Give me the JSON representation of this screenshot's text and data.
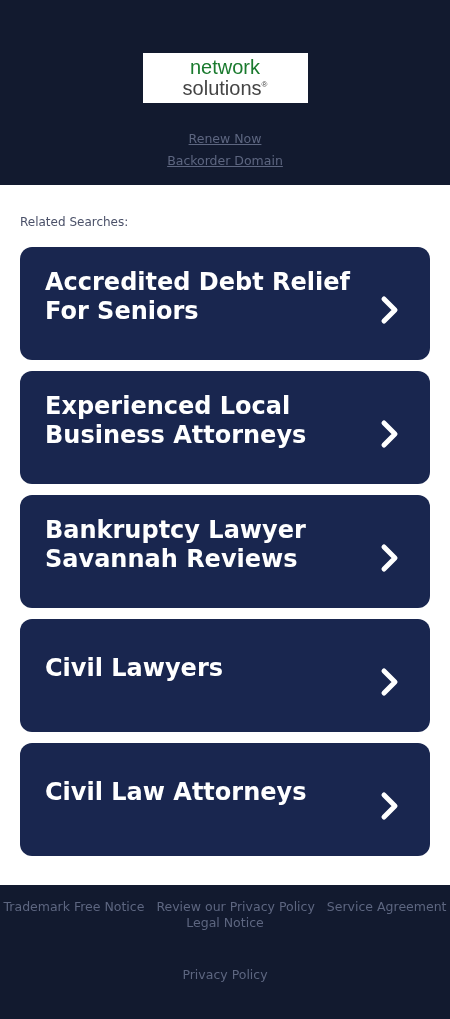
{
  "header": {
    "logo": {
      "line_1": "network",
      "line_2": "solutions$^{®}$"
    },
    "links": [
      "Renew Now",
      "Backorder Domain"
    ]
  },
  "related_searches": {
    "title": "Related Searches:",
    "items": [
      "Accredited Debt Relief For Seniors",
      "Experienced Local Business Attorneys",
      "Bankruptcy Lawyer Savannah Reviews",
      "Civil Lawyers",
      "Civil Law Attorneys"
    ]
  },
  "footer": {
    "links": [
      "Trademark Free Notice",
      "Review our Privacy Policy",
      "Service Agreement",
      "Legal Notice"
    ],
    "privacy_policy": "Privacy Policy"
  }
}
